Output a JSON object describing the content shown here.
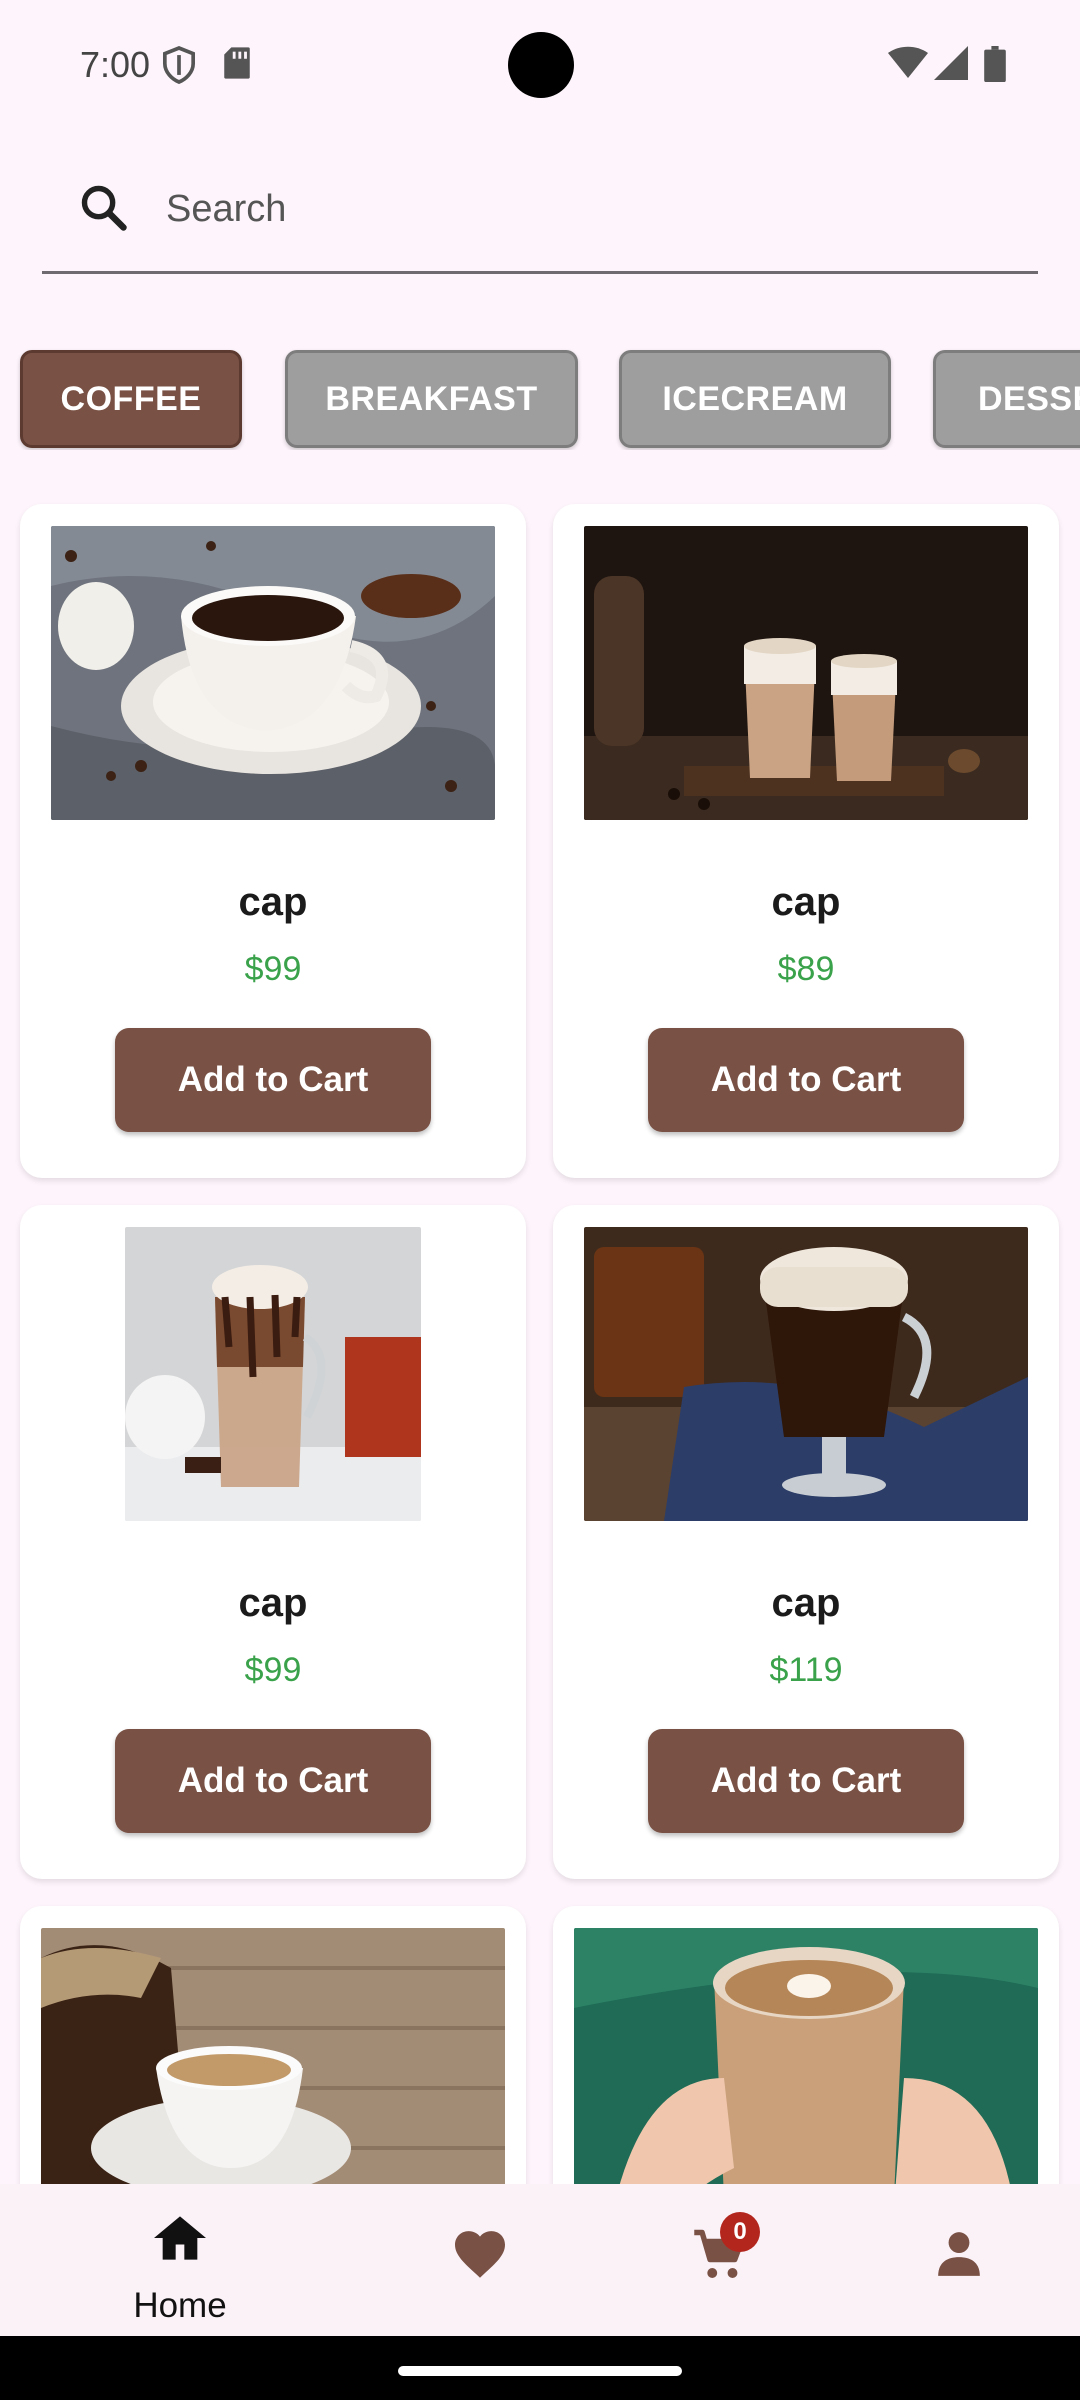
{
  "status_bar": {
    "time": "7:00",
    "icons": [
      "shield-icon",
      "sd-card-icon",
      "wifi-icon",
      "signal-icon",
      "battery-icon"
    ]
  },
  "search": {
    "placeholder": "Search"
  },
  "categories": [
    {
      "label": "COFFEE",
      "active": true
    },
    {
      "label": "BREAKFAST",
      "active": false
    },
    {
      "label": "ICECREAM",
      "active": false
    },
    {
      "label": "DESSERT",
      "active": false
    }
  ],
  "products": [
    {
      "name": "cap",
      "price": "$99",
      "button": "Add to Cart",
      "image": "coffee-cup-image"
    },
    {
      "name": "cap",
      "price": "$89",
      "button": "Add to Cart",
      "image": "latte-glasses-image"
    },
    {
      "name": "cap",
      "price": "$99",
      "button": "Add to Cart",
      "image": "mocha-glass-image"
    },
    {
      "name": "cap",
      "price": "$119",
      "button": "Add to Cart",
      "image": "irish-coffee-image"
    },
    {
      "image": "espresso-beans-image"
    },
    {
      "image": "cappuccino-hands-image"
    }
  ],
  "bottom_nav": {
    "home_label": "Home",
    "cart_count": "0",
    "items": [
      "home-icon",
      "heart-icon",
      "cart-icon",
      "person-icon"
    ]
  },
  "colors": {
    "accent": "#7a5245",
    "price": "#3aa24a",
    "chip_inactive": "#9e9e9e",
    "background": "#fdf5fb",
    "badge": "#b3261e"
  }
}
